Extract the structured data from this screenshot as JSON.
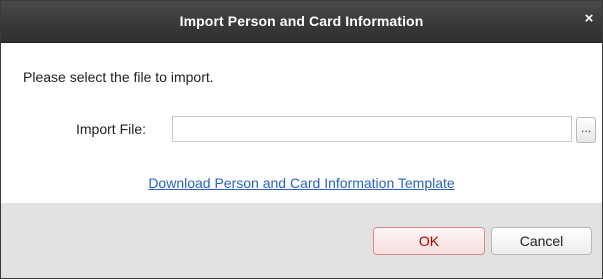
{
  "dialog": {
    "title": "Import Person and Card Information",
    "close_glyph": "×"
  },
  "body": {
    "prompt": "Please select the file to import.",
    "import_file_label": "Import File:",
    "import_file_value": "",
    "browse_label": "...",
    "template_link": "Download Person and Card Information Template"
  },
  "footer": {
    "ok_label": "OK",
    "cancel_label": "Cancel"
  },
  "colors": {
    "titlebar": "#3a3a3a",
    "link": "#2a62b8",
    "ok_text": "#b10000",
    "footer_bg": "#e2e2e2"
  },
  "icons": {
    "close": "close-icon",
    "browse": "ellipsis-icon"
  }
}
